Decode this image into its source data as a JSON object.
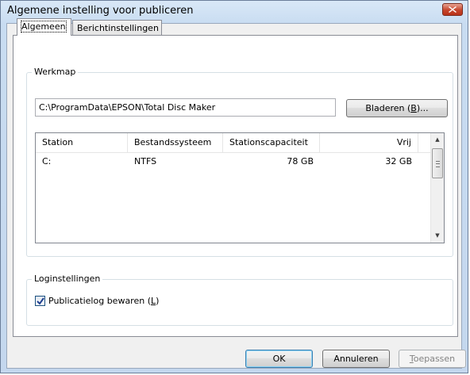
{
  "window": {
    "title": "Algemene instelling voor publiceren"
  },
  "tabs": [
    {
      "label": "Algemeen",
      "active": true
    },
    {
      "label": "Berichtinstellingen",
      "active": false
    }
  ],
  "werkmap": {
    "group_label": "Werkmap",
    "path_value": "C:\\ProgramData\\EPSON\\Total Disc Maker",
    "browse_label_pre": "Bladeren (",
    "browse_accel": "B",
    "browse_label_post": ")..."
  },
  "drives": {
    "columns": [
      "Station",
      "Bestandssysteem",
      "Stationscapaciteit",
      "Vrij"
    ],
    "rows": [
      {
        "station": "C:",
        "fs": "NTFS",
        "capacity": "78 GB",
        "free": "32 GB"
      }
    ]
  },
  "login": {
    "group_label": "Loginstellingen",
    "checkbox_label_pre": "Publicatielog bewaren (",
    "checkbox_accel": "L",
    "checkbox_label_post": ")",
    "checked": true
  },
  "footer": {
    "ok_label": "OK",
    "cancel_label": "Annuleren",
    "apply_accel": "T",
    "apply_label_rest": "oepassen"
  },
  "icons": {
    "close": "close-icon",
    "checkmark": "checkmark-icon",
    "scroll_up": "arrow-up-icon",
    "scroll_down": "arrow-down-icon"
  },
  "colors": {
    "title_gradient_top": "#d9e8f7",
    "close_red": "#c6452c",
    "default_button_border": "#3c7fb1"
  }
}
